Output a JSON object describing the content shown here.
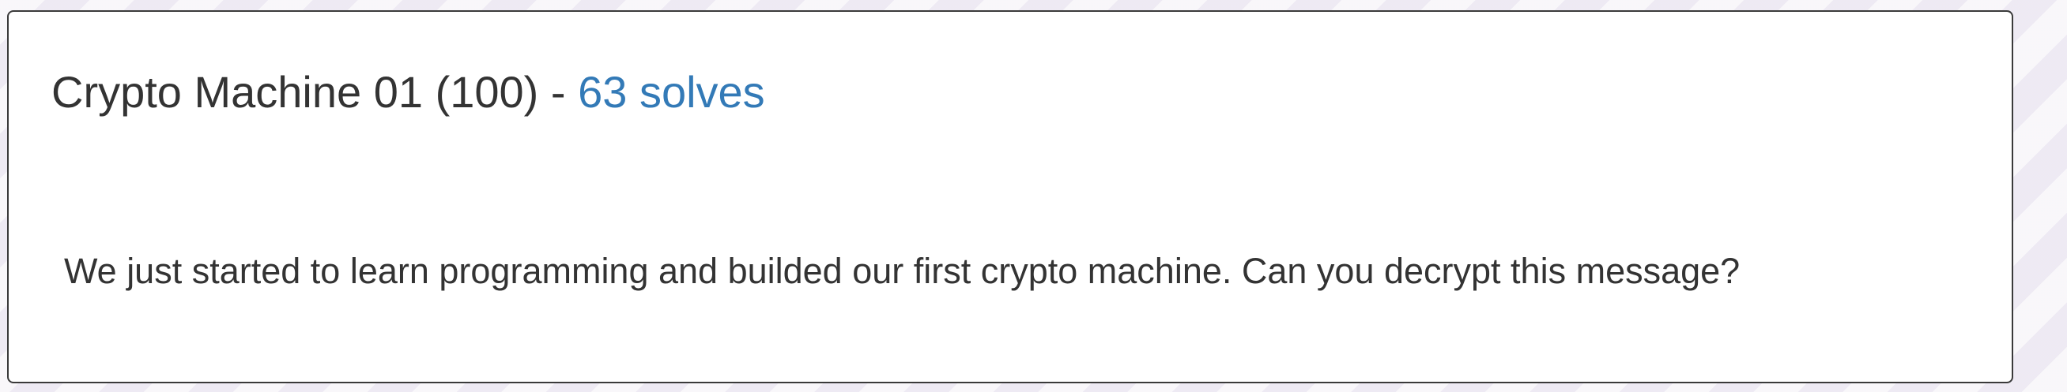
{
  "challenge": {
    "name": "Crypto Machine 01",
    "points_text": "(100)",
    "separator": "-",
    "solves_text": "63 solves",
    "description": "We just started to learn programming and builded our first crypto machine. Can you decrypt this message?"
  },
  "colors": {
    "title": "#333333",
    "solves_link": "#337ab7",
    "card_border": "#3a3a3a",
    "card_background": "#ffffff"
  }
}
